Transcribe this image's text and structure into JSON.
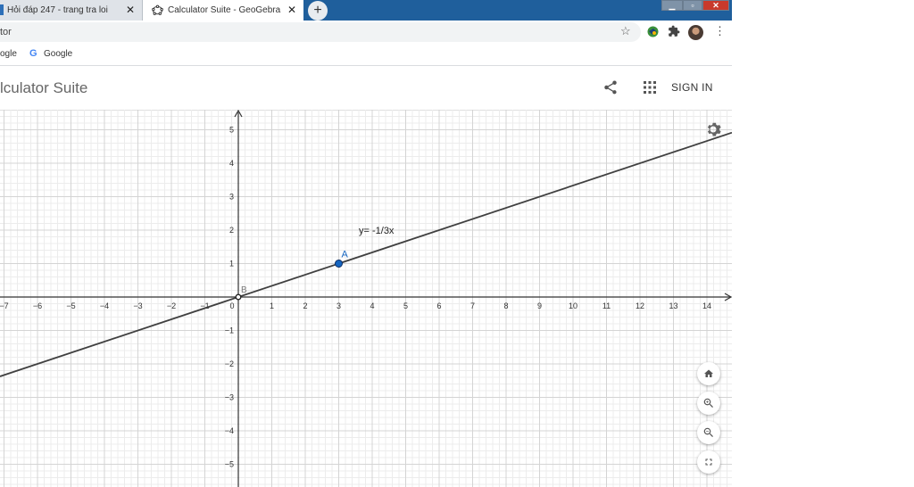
{
  "browser": {
    "tabs": [
      {
        "label": "Hỏi đáp 247 - trang tra loi",
        "active": false
      },
      {
        "label": "Calculator Suite - GeoGebra",
        "active": true
      }
    ],
    "tab_close_glyph": "✕",
    "new_tab_glyph": "+",
    "window_controls": {
      "minimize": "▁",
      "maximize": "▫",
      "close": "✕"
    },
    "address_text": "tor",
    "bookmarks": [
      {
        "label": "ogle"
      },
      {
        "label": "Google",
        "icon": "G"
      }
    ],
    "icons": [
      "star-icon",
      "extension-icon",
      "puzzle-icon",
      "avatar",
      "menu-dots-icon"
    ]
  },
  "app": {
    "title": "lculator Suite",
    "sign_in_label": "SIGN IN",
    "icons": [
      "share-icon",
      "apps-grid-icon",
      "settings-gear-icon",
      "home-icon",
      "zoom-in-icon",
      "zoom-out-icon",
      "fullscreen-icon"
    ]
  },
  "graph": {
    "x_ticks": [
      "−7",
      "−6",
      "−5",
      "−4",
      "−3",
      "−2",
      "−1",
      "0",
      "1",
      "2",
      "3",
      "4",
      "5",
      "6",
      "7",
      "8",
      "9",
      "10",
      "11",
      "12",
      "13",
      "14"
    ],
    "y_ticks_pos": [
      "5",
      "4",
      "3",
      "2",
      "1"
    ],
    "y_ticks_neg": [
      "−1",
      "−2",
      "−3",
      "−4",
      "−5"
    ],
    "line_label": "y= -1/3x",
    "points": [
      {
        "label": "A",
        "x": 3,
        "y": 1
      },
      {
        "label": "B",
        "x": 0,
        "y": 0
      }
    ],
    "line": {
      "slope": 0.3333,
      "intercept": 0
    },
    "colors": {
      "grid_minor": "#ececec",
      "grid_major": "#d4d4d4",
      "axis": "#333333",
      "line": "#404040",
      "point_A": "#1565c0"
    }
  }
}
